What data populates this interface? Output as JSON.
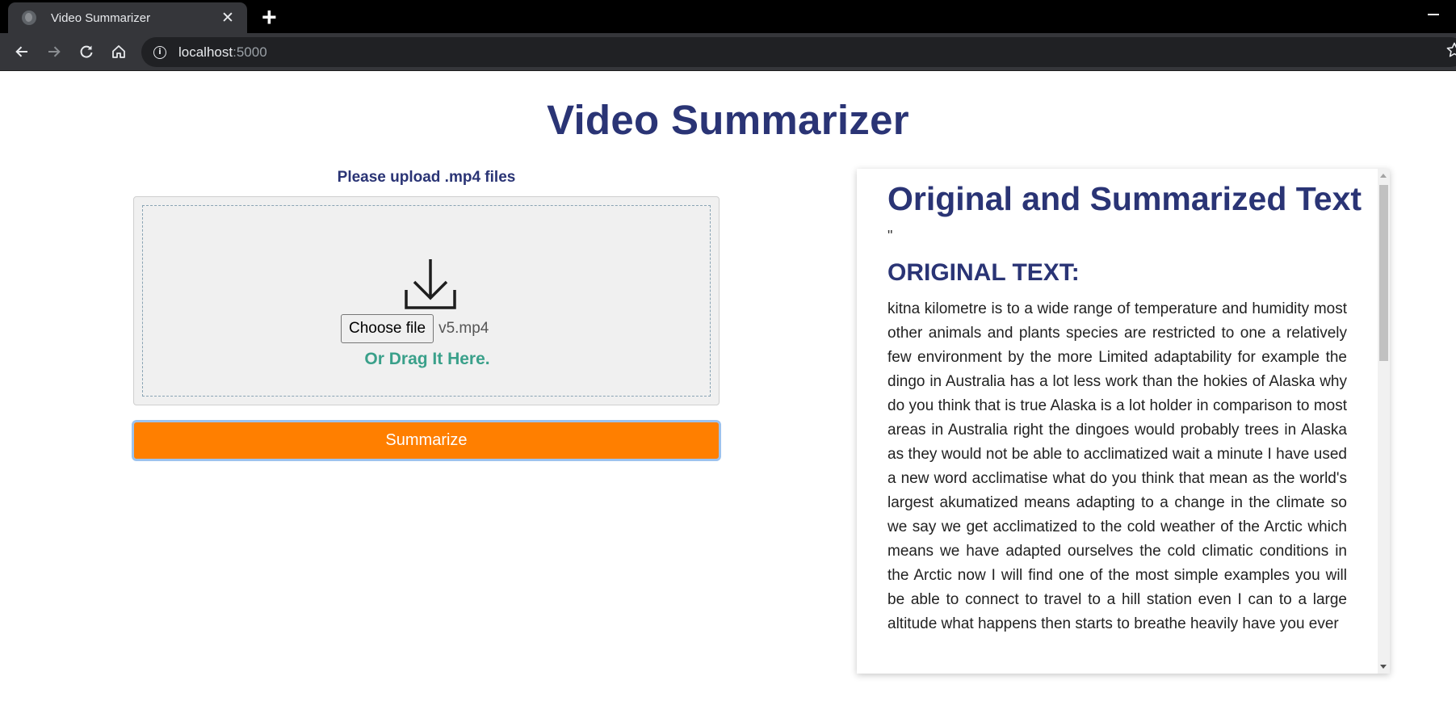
{
  "browser": {
    "tab_title": "Video Summarizer",
    "tab_close": "✕",
    "new_tab": "+",
    "url_host": "localhost",
    "url_port": ":5000"
  },
  "page": {
    "title": "Video Summarizer",
    "upload_label": "Please upload .mp4 files",
    "choose_file_label": "Choose file",
    "file_name": "v5.mp4",
    "drag_text": "Or Drag It Here.",
    "summarize_label": "Summarize"
  },
  "panel": {
    "title": "Original and Summarized Text",
    "quote_mark": "\"",
    "original_heading": "ORIGINAL TEXT:",
    "original_text": "kitna kilometre is to a wide range of temperature and humidity most other animals and plants species are restricted to one a relatively few environment by the more Limited adaptability for example the dingo in Australia has a lot less work than the hokies of Alaska why do you think that is true Alaska is a lot holder in comparison to most areas in Australia right the dingoes would probably trees in Alaska as they would not be able to acclimatized wait a minute I have used a new word acclimatise what do you think that mean as the world's largest akumatized means adapting to a change in the climate so we say we get acclimatized to the cold weather of the Arctic which means we have adapted ourselves the cold climatic conditions in the Arctic now I will find one of the most simple examples you will be able to connect to travel to a hill station even I can to a large altitude what happens then starts to breathe heavily have you ever"
  },
  "colors": {
    "title": "#2a3475",
    "accent_button": "#ff7f00",
    "drag_text": "#3aa08a"
  },
  "icons": [
    "globe-icon",
    "close-icon",
    "plus-icon",
    "back-arrow-icon",
    "forward-arrow-icon",
    "reload-icon",
    "home-icon",
    "info-icon",
    "star-icon",
    "download-icon"
  ]
}
